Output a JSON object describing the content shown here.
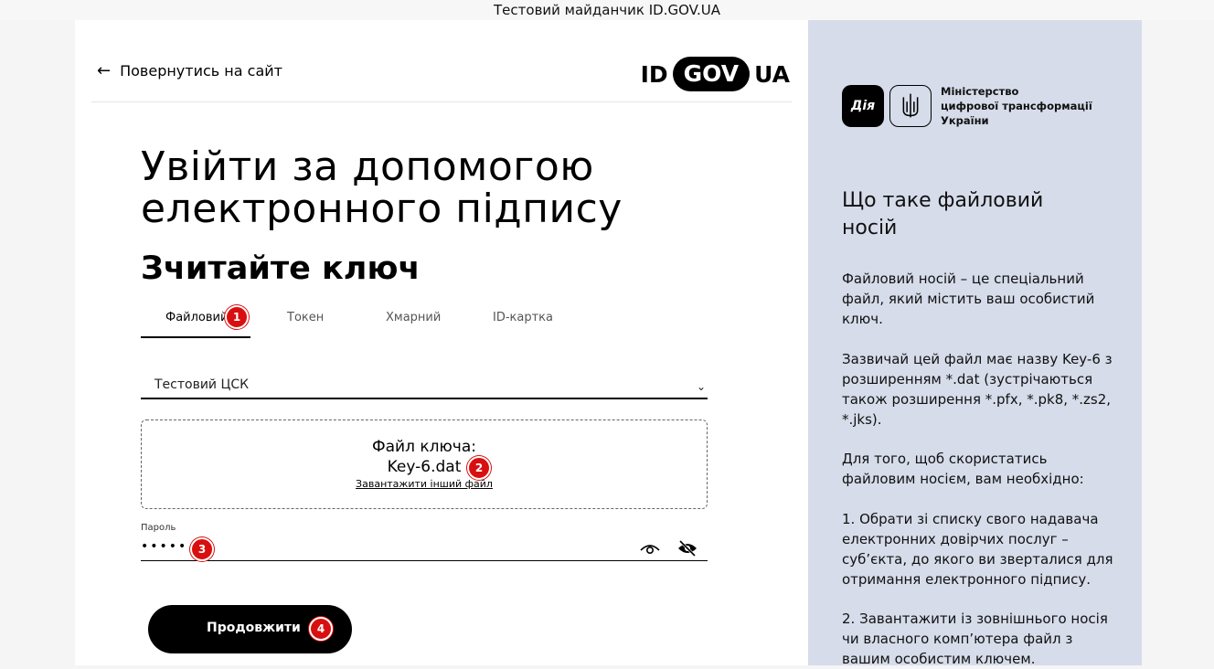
{
  "topbar": {
    "title": "Тестовий майданчик ID.GOV.UA"
  },
  "header": {
    "back_label": "Повернутись на сайт",
    "logo": {
      "left": "ID",
      "middle": "GOV",
      "right": "UA"
    }
  },
  "main": {
    "title_line1": "Увійти за допомогою",
    "title_line2": "електронного підпису",
    "subtitle": "Зчитайте ключ",
    "tabs": [
      {
        "label": "Файловий",
        "active": true
      },
      {
        "label": "Токен",
        "active": false
      },
      {
        "label": "Хмарний",
        "active": false
      },
      {
        "label": "ID-картка",
        "active": false
      }
    ],
    "ca_select": {
      "value": "Тестовий ЦСК"
    },
    "dropzone": {
      "title": "Файл ключа:",
      "filename": "Key-6.dat",
      "link": "Завантажити інший файл"
    },
    "password": {
      "label": "Пароль",
      "value": "•••••"
    },
    "submit_label": "Продовжити"
  },
  "badges": [
    "1",
    "2",
    "3",
    "4"
  ],
  "sidebar": {
    "diia_label": "Дія",
    "ministry_line1": "Міністерство",
    "ministry_line2": "цифрової трансформації",
    "ministry_line3": "України",
    "heading_line1": "Що таке файловий",
    "heading_line2": "носій",
    "paragraphs": [
      "Файловий носій – це спеціальний файл, який містить ваш особистий ключ.",
      "Зазвичай цей файл має назву Key-6 з розширенням *.dat (зустрічаються також розширення *.pfx, *.pk8, *.zs2, *.jks).",
      "Для того, щоб скористатись файловим носієм, вам необхідно:",
      "1. Обрати зі списку свого надавача електронних довірчих послуг – суб’єкта, до якого ви зверталися для отримання електронного підпису.",
      "2. Завантажити із зовнішнього носія чи власного комп’ютера файл з вашим особистим ключем."
    ]
  },
  "colors": {
    "badge": "#d90f0f",
    "sidebar_bg": "#d6dcea",
    "button_bg": "#000000"
  }
}
